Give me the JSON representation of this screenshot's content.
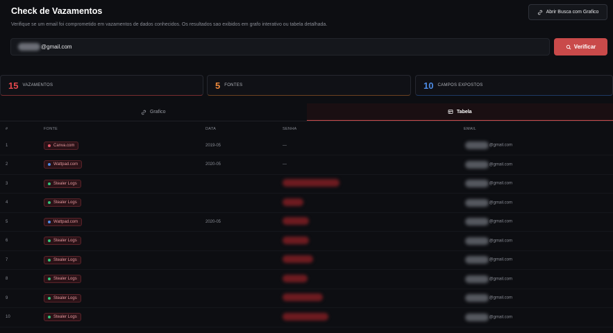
{
  "header": {
    "title": "Check de Vazamentos",
    "subtitle": "Verifique se um email foi comprometido em vazamentos de dados conhecidos. Os resultados sao exibidos em grafo interativo ou tabela detalhada.",
    "open_button": "Abrir Busca com Grafico"
  },
  "search": {
    "value": "@gmail.com",
    "verify_button": "Verificar"
  },
  "stats": [
    {
      "value": "15",
      "label": "VAZAMENTOS",
      "color": "#e5484d"
    },
    {
      "value": "5",
      "label": "FONTES",
      "color": "#f08a3c"
    },
    {
      "value": "10",
      "label": "CAMPOS EXPOSTOS",
      "color": "#4d8ce6"
    }
  ],
  "tabs": [
    {
      "label": "Grafico",
      "active": false
    },
    {
      "label": "Tabela",
      "active": true
    }
  ],
  "table": {
    "columns": [
      "#",
      "FONTE",
      "DATA",
      "SENHA",
      "EMAIL"
    ],
    "rows": [
      {
        "num": "1",
        "source": "Canva.com",
        "date": "2019-05",
        "password": "—",
        "email": "@gmail.com"
      },
      {
        "num": "2",
        "source": "Wattpad.com",
        "date": "2020-05",
        "password": "—",
        "email": "@gmail.com"
      },
      {
        "num": "3",
        "source": "Stealer Logs",
        "date": "",
        "password": "",
        "email": "@gmail.com"
      },
      {
        "num": "4",
        "source": "Stealer Logs",
        "date": "",
        "password": "",
        "email": "@gmail.com"
      },
      {
        "num": "5",
        "source": "Wattpad.com",
        "date": "2020-05",
        "password": "",
        "email": "@gmail.com"
      },
      {
        "num": "6",
        "source": "Stealer Logs",
        "date": "",
        "password": "",
        "email": "@gmail.com"
      },
      {
        "num": "7",
        "source": "Stealer Logs",
        "date": "",
        "password": "",
        "email": "@gmail.com"
      },
      {
        "num": "8",
        "source": "Stealer Logs",
        "date": "",
        "password": "",
        "email": "@gmail.com"
      },
      {
        "num": "9",
        "source": "Stealer Logs",
        "date": "",
        "password": "",
        "email": "@gmail.com"
      },
      {
        "num": "10",
        "source": "Stealer Logs",
        "date": "",
        "password": "",
        "email": "@gmail.com"
      }
    ]
  }
}
